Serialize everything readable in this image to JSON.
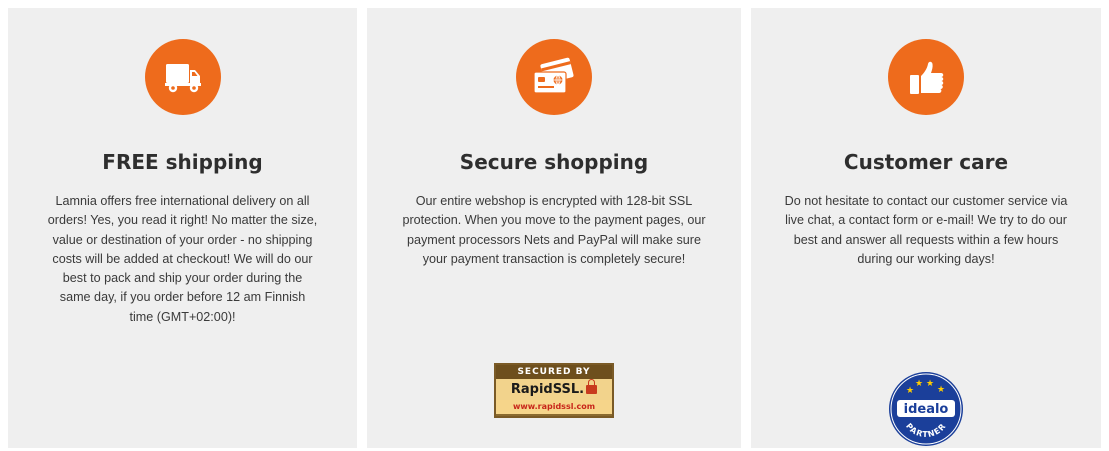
{
  "features": [
    {
      "title": "FREE shipping",
      "description": "Lamnia offers free international delivery on all orders! Yes, you read it right! No matter the size, value or destination of your order - no shipping costs will be added at checkout! We will do our best to pack and ship your order during the same day, if you order before 12 am Finnish time (GMT+02:00)!",
      "icon": "truck-icon"
    },
    {
      "title": "Secure shopping",
      "description": "Our entire webshop is encrypted with 128-bit SSL protection. When you move to the payment pages, our payment processors Nets and PayPal will make sure your payment transaction is completely secure!",
      "icon": "credit-card-icon",
      "badge": {
        "top": "SECURED BY",
        "brand": "RapidSSL.",
        "url": "www.rapidssl.com"
      }
    },
    {
      "title": "Customer care",
      "description": "Do not hesitate to contact our customer service via live chat, a contact form or e-mail! We try to do our best and answer all requests within a few hours during our working days!",
      "icon": "thumbs-up-icon",
      "badge": {
        "brand": "idealo",
        "sub": "PARTNER"
      }
    }
  ],
  "colors": {
    "accent": "#ee6b1c",
    "panel_bg": "#efefef",
    "title_text": "#2e2e2e",
    "body_text": "#3a3a3a"
  }
}
